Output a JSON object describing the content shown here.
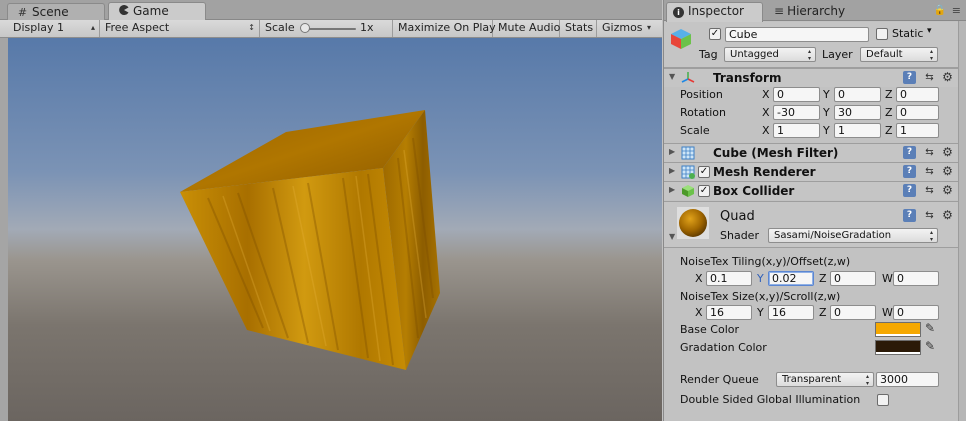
{
  "game_panel": {
    "tabs": [
      {
        "label": "Scene",
        "icon": "hash-icon"
      },
      {
        "label": "Game",
        "icon": "pacman-icon"
      }
    ],
    "toolbar": {
      "display": "Display 1",
      "aspect": "Free Aspect",
      "scale_label": "Scale",
      "scale_value": "1x",
      "maximize": "Maximize On Play",
      "mute": "Mute Audio",
      "stats": "Stats",
      "gizmos": "Gizmos"
    }
  },
  "inspector": {
    "tabs": [
      {
        "label": "Inspector",
        "icon": "info-icon"
      },
      {
        "label": "Hierarchy",
        "icon": "list-icon"
      }
    ],
    "object": {
      "active": true,
      "name": "Cube",
      "static_label": "Static",
      "static": false,
      "tag_label": "Tag",
      "tag": "Untagged",
      "layer_label": "Layer",
      "layer": "Default"
    },
    "transform": {
      "title": "Transform",
      "position_label": "Position",
      "rotation_label": "Rotation",
      "scale_label": "Scale",
      "axis_x": "X",
      "axis_y": "Y",
      "axis_z": "Z",
      "position": {
        "x": "0",
        "y": "0",
        "z": "0"
      },
      "rotation": {
        "x": "-30",
        "y": "30",
        "z": "0"
      },
      "scale": {
        "x": "1",
        "y": "1",
        "z": "1"
      }
    },
    "components": [
      {
        "title": "Cube (Mesh Filter)",
        "has_checkbox": false
      },
      {
        "title": "Mesh Renderer",
        "has_checkbox": true
      },
      {
        "title": "Box Collider",
        "has_checkbox": true
      }
    ],
    "material": {
      "name": "Quad",
      "shader_label": "Shader",
      "shader": "Sasami/NoiseGradation",
      "tiling_label": "NoiseTex Tiling(x,y)/Offset(z,w)",
      "tiling": {
        "x": "0.1",
        "y": "0.02",
        "z": "0",
        "w": "0"
      },
      "size_label": "NoiseTex Size(x,y)/Scroll(z,w)",
      "size": {
        "x": "16",
        "y": "16",
        "z": "0",
        "w": "0"
      },
      "axis_w": "W",
      "base_color_label": "Base Color",
      "base_color": "#f5a800",
      "gradation_label": "Gradation Color",
      "gradation_color": "#2b1a08",
      "render_queue_label": "Render Queue",
      "render_queue_mode": "Transparent",
      "render_queue_value": "3000",
      "double_sided_label": "Double Sided Global Illumination",
      "double_sided": false
    }
  }
}
